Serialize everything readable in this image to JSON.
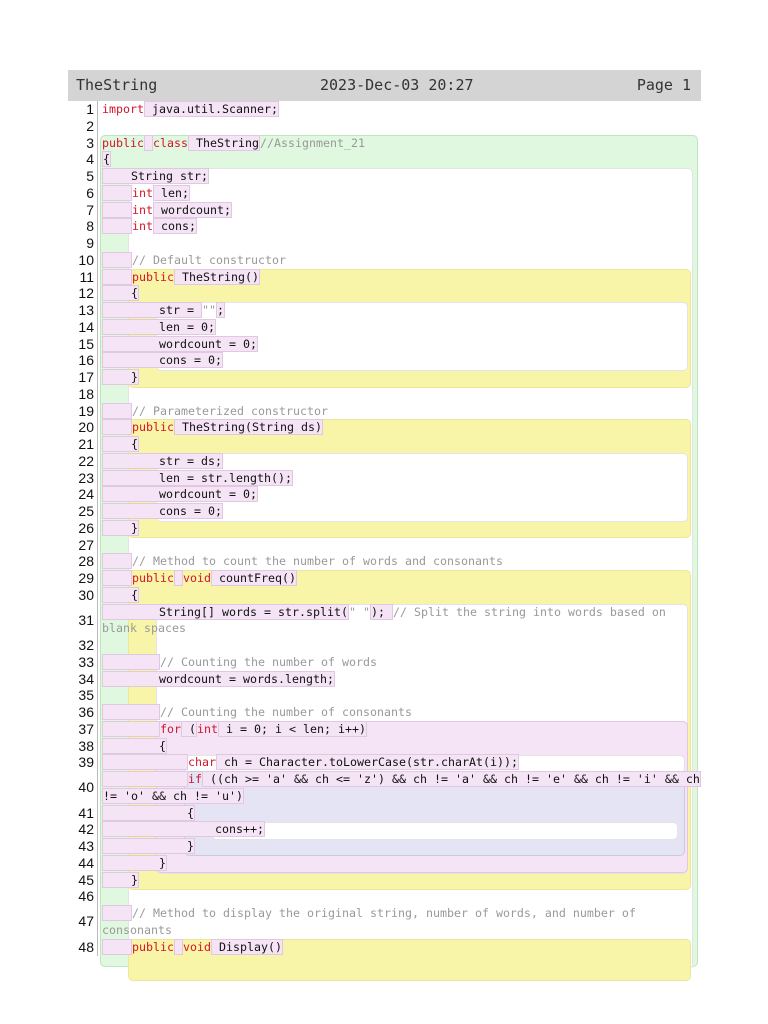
{
  "header": {
    "title": "TheString",
    "datetime": "2023-Dec-03 20:27",
    "page": "Page 1"
  },
  "colors": {
    "keyword": "#d4142a",
    "comment": "#999999",
    "class_block": "#e0f7e0",
    "method_block": "#f9f5a8",
    "loop_block": "#f5e4f5",
    "if_block": "#e4e4f4"
  },
  "lines": [
    {
      "n": "1",
      "rows": [
        [
          [
            "k",
            "import"
          ],
          [
            "p",
            " java.util.Scanner;"
          ]
        ]
      ]
    },
    {
      "n": "2",
      "rows": [
        []
      ]
    },
    {
      "n": "3",
      "rows": [
        [
          [
            "k",
            "public"
          ],
          [
            "p",
            " "
          ],
          [
            "k",
            "class"
          ],
          [
            "p",
            " TheString"
          ],
          [
            "c",
            "//Assignment_21"
          ]
        ]
      ]
    },
    {
      "n": "4",
      "rows": [
        [
          [
            "p",
            "{"
          ]
        ]
      ]
    },
    {
      "n": "5",
      "rows": [
        [
          [
            "p",
            "    String str;"
          ]
        ]
      ]
    },
    {
      "n": "6",
      "rows": [
        [
          [
            "p",
            "    "
          ],
          [
            "k",
            "int"
          ],
          [
            "p",
            " len;"
          ]
        ]
      ]
    },
    {
      "n": "7",
      "rows": [
        [
          [
            "p",
            "    "
          ],
          [
            "k",
            "int"
          ],
          [
            "p",
            " wordcount;"
          ]
        ]
      ]
    },
    {
      "n": "8",
      "rows": [
        [
          [
            "p",
            "    "
          ],
          [
            "k",
            "int"
          ],
          [
            "p",
            " cons;"
          ]
        ]
      ]
    },
    {
      "n": "9",
      "rows": [
        []
      ]
    },
    {
      "n": "10",
      "rows": [
        [
          [
            "p",
            "    "
          ],
          [
            "c",
            "// Default constructor"
          ]
        ]
      ]
    },
    {
      "n": "11",
      "rows": [
        [
          [
            "p",
            "    "
          ],
          [
            "k",
            "public"
          ],
          [
            "p",
            " TheString()"
          ]
        ]
      ]
    },
    {
      "n": "12",
      "rows": [
        [
          [
            "p",
            "    {"
          ]
        ]
      ]
    },
    {
      "n": "13",
      "rows": [
        [
          [
            "p",
            "        str = "
          ],
          [
            "s",
            "\"\""
          ],
          [
            "p",
            ";"
          ]
        ]
      ]
    },
    {
      "n": "14",
      "rows": [
        [
          [
            "p",
            "        len = 0;"
          ]
        ]
      ]
    },
    {
      "n": "15",
      "rows": [
        [
          [
            "p",
            "        wordcount = 0;"
          ]
        ]
      ]
    },
    {
      "n": "16",
      "rows": [
        [
          [
            "p",
            "        cons = 0;"
          ]
        ]
      ]
    },
    {
      "n": "17",
      "rows": [
        [
          [
            "p",
            "    }"
          ]
        ]
      ]
    },
    {
      "n": "18",
      "rows": [
        []
      ]
    },
    {
      "n": "19",
      "rows": [
        [
          [
            "p",
            "    "
          ],
          [
            "c",
            "// Parameterized constructor"
          ]
        ]
      ]
    },
    {
      "n": "20",
      "rows": [
        [
          [
            "p",
            "    "
          ],
          [
            "k",
            "public"
          ],
          [
            "p",
            " TheString(String ds)"
          ]
        ]
      ]
    },
    {
      "n": "21",
      "rows": [
        [
          [
            "p",
            "    {"
          ]
        ]
      ]
    },
    {
      "n": "22",
      "rows": [
        [
          [
            "p",
            "        str = ds;"
          ]
        ]
      ]
    },
    {
      "n": "23",
      "rows": [
        [
          [
            "p",
            "        len = str.length();"
          ]
        ]
      ]
    },
    {
      "n": "24",
      "rows": [
        [
          [
            "p",
            "        wordcount = 0;"
          ]
        ]
      ]
    },
    {
      "n": "25",
      "rows": [
        [
          [
            "p",
            "        cons = 0;"
          ]
        ]
      ]
    },
    {
      "n": "26",
      "rows": [
        [
          [
            "p",
            "    }"
          ]
        ]
      ]
    },
    {
      "n": "27",
      "rows": [
        []
      ]
    },
    {
      "n": "28",
      "rows": [
        [
          [
            "p",
            "    "
          ],
          [
            "c",
            "// Method to count the number of words and consonants"
          ]
        ]
      ]
    },
    {
      "n": "29",
      "rows": [
        [
          [
            "p",
            "    "
          ],
          [
            "k",
            "public"
          ],
          [
            "p",
            " "
          ],
          [
            "k",
            "void"
          ],
          [
            "p",
            " countFreq()"
          ]
        ]
      ]
    },
    {
      "n": "30",
      "rows": [
        [
          [
            "p",
            "    {"
          ]
        ]
      ]
    },
    {
      "n": "31",
      "rows": [
        [
          [
            "p",
            "        String[] words = str.split("
          ],
          [
            "s",
            "\" \""
          ],
          [
            "p",
            "); "
          ],
          [
            "c",
            "// Split the string into words based on"
          ]
        ],
        [
          [
            "c",
            "blank spaces"
          ]
        ]
      ]
    },
    {
      "n": "32",
      "rows": [
        []
      ]
    },
    {
      "n": "33",
      "rows": [
        [
          [
            "p",
            "        "
          ],
          [
            "c",
            "// Counting the number of words"
          ]
        ]
      ]
    },
    {
      "n": "34",
      "rows": [
        [
          [
            "p",
            "        wordcount = words.length;"
          ]
        ]
      ]
    },
    {
      "n": "35",
      "rows": [
        []
      ]
    },
    {
      "n": "36",
      "rows": [
        [
          [
            "p",
            "        "
          ],
          [
            "c",
            "// Counting the number of consonants"
          ]
        ]
      ]
    },
    {
      "n": "37",
      "rows": [
        [
          [
            "p",
            "        "
          ],
          [
            "k",
            "for"
          ],
          [
            "p",
            " ("
          ],
          [
            "k",
            "int"
          ],
          [
            "p",
            " i = 0; i < len; i++)"
          ]
        ]
      ]
    },
    {
      "n": "38",
      "rows": [
        [
          [
            "p",
            "        {"
          ]
        ]
      ]
    },
    {
      "n": "39",
      "rows": [
        [
          [
            "p",
            "            "
          ],
          [
            "k",
            "char"
          ],
          [
            "p",
            " ch = Character.toLowerCase(str.charAt(i));"
          ]
        ]
      ]
    },
    {
      "n": "40",
      "rows": [
        [
          [
            "p",
            "            "
          ],
          [
            "k",
            "if"
          ],
          [
            "p",
            " ((ch >= 'a' && ch <= 'z') && ch != 'a' && ch != 'e' && ch != 'i' && ch"
          ]
        ],
        [
          [
            "p",
            "!= 'o' && ch != 'u')"
          ]
        ]
      ]
    },
    {
      "n": "41",
      "rows": [
        [
          [
            "p",
            "            {"
          ]
        ]
      ]
    },
    {
      "n": "42",
      "rows": [
        [
          [
            "p",
            "                cons++;"
          ]
        ]
      ]
    },
    {
      "n": "43",
      "rows": [
        [
          [
            "p",
            "            }"
          ]
        ]
      ]
    },
    {
      "n": "44",
      "rows": [
        [
          [
            "p",
            "        }"
          ]
        ]
      ]
    },
    {
      "n": "45",
      "rows": [
        [
          [
            "p",
            "    }"
          ]
        ]
      ]
    },
    {
      "n": "46",
      "rows": [
        []
      ]
    },
    {
      "n": "47",
      "rows": [
        [
          [
            "p",
            "    "
          ],
          [
            "c",
            "// Method to display the original string, number of words, and number of"
          ]
        ],
        [
          [
            "c",
            "consonants"
          ]
        ]
      ]
    },
    {
      "n": "48",
      "rows": [
        [
          [
            "p",
            "    "
          ],
          [
            "k",
            "public"
          ],
          [
            "p",
            " "
          ],
          [
            "k",
            "void"
          ],
          [
            "p",
            " Display()"
          ]
        ]
      ]
    }
  ]
}
